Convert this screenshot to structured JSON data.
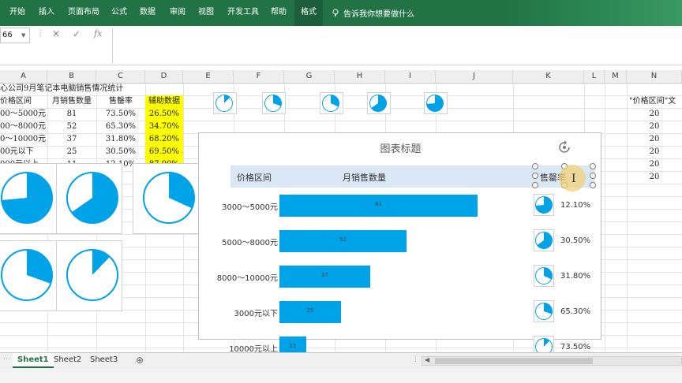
{
  "ribbon": {
    "tabs": [
      "开始",
      "插入",
      "页面布局",
      "公式",
      "数据",
      "审阅",
      "视图",
      "开发工具",
      "帮助",
      "格式"
    ],
    "tell_me": "告诉我你想要做什么"
  },
  "formula_bar": {
    "name_box": "66",
    "fx": "fx"
  },
  "columns": [
    "A",
    "B",
    "C",
    "D",
    "E",
    "F",
    "G",
    "H",
    "I",
    "J",
    "K",
    "L",
    "M",
    "N"
  ],
  "sheet": {
    "title": "心公司9月笔记本电脑销售情况统计",
    "headers": [
      "价格区间",
      "月销售数量",
      "售罄率",
      "辅助数据"
    ],
    "rows": [
      {
        "range": "00～5000元",
        "qty": "81",
        "rate": "73.50%",
        "aux": "26.50%"
      },
      {
        "range": "00～8000元",
        "qty": "52",
        "rate": "65.30%",
        "aux": "34.70%"
      },
      {
        "range": "0～10000元",
        "qty": "37",
        "rate": "31.80%",
        "aux": "68.20%"
      },
      {
        "range": "00元以下",
        "qty": "25",
        "rate": "30.50%",
        "aux": "69.50%"
      },
      {
        "range": "000元以上",
        "qty": "11",
        "rate": "12.10%",
        "aux": "87.90%"
      }
    ],
    "col_n_header": "\"价格区间\"文",
    "col_n_values": [
      "20",
      "20",
      "20",
      "20",
      "20",
      "20"
    ]
  },
  "chart": {
    "title": "图表标题",
    "header_range": "价格区间",
    "header_qty": "月销售数量",
    "header_rate": "售罄率",
    "cursor_glyph": "I",
    "accent": "#00a2e8",
    "header_bg": "#dae7f5"
  },
  "chart_data": {
    "type": "bar",
    "categories": [
      "3000～5000元",
      "5000～8000元",
      "8000～10000元",
      "3000元以下",
      "10000元以上"
    ],
    "values": [
      81,
      52,
      37,
      25,
      11
    ],
    "xlim": [
      0,
      100
    ],
    "pie_fractions": [
      0.121,
      0.305,
      0.318,
      0.653,
      0.735
    ],
    "pie_labels": [
      "12.10%",
      "30.50%",
      "31.80%",
      "65.30%",
      "73.50%"
    ]
  },
  "sheet_tabs": [
    "Sheet1",
    "Sheet2",
    "Sheet3"
  ],
  "add_sheet": "⊕"
}
